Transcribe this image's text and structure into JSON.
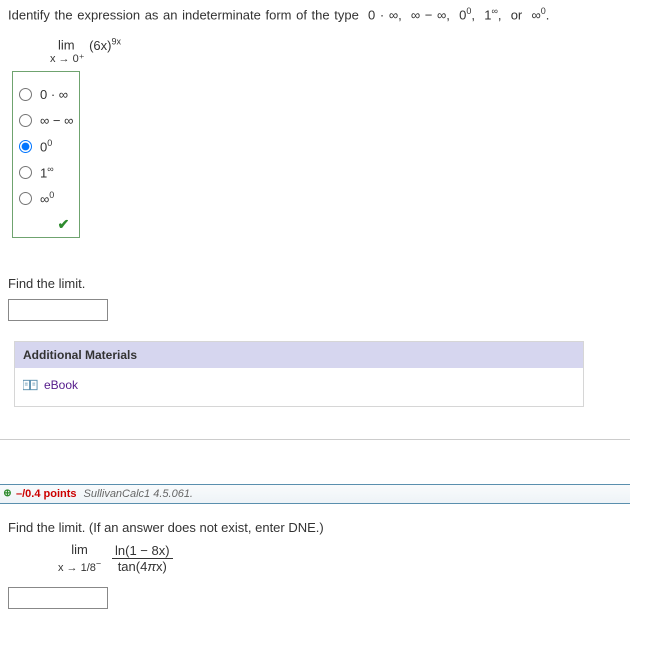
{
  "q1": {
    "prompt_lead": "Identify the expression as an indeterminate form of the type",
    "types": [
      "0 · ∞,",
      "∞ − ∞,",
      "0⁰,",
      "1^∞,",
      "or ∞⁰."
    ],
    "limit_top": "lim",
    "limit_bot": "x → 0⁺",
    "limit_fn": "(6x)",
    "limit_exp": "9x",
    "options": [
      "0 · ∞",
      "∞ − ∞",
      "0⁰",
      "1^∞",
      "∞⁰"
    ],
    "selected": 2,
    "subprompt": "Find the limit."
  },
  "materials": {
    "header": "Additional Materials",
    "ebook": "eBook"
  },
  "q2": {
    "points": "–/0.4 points",
    "source": "SullivanCalc1 4.5.061.",
    "prompt": "Find the limit. (If an answer does not exist, enter DNE.)",
    "limit_top": "lim",
    "limit_bot": "x → 1/8⁻",
    "frac_num": "ln(1 − 8x)",
    "frac_den": "tan(4πx)"
  },
  "chart_data": null
}
